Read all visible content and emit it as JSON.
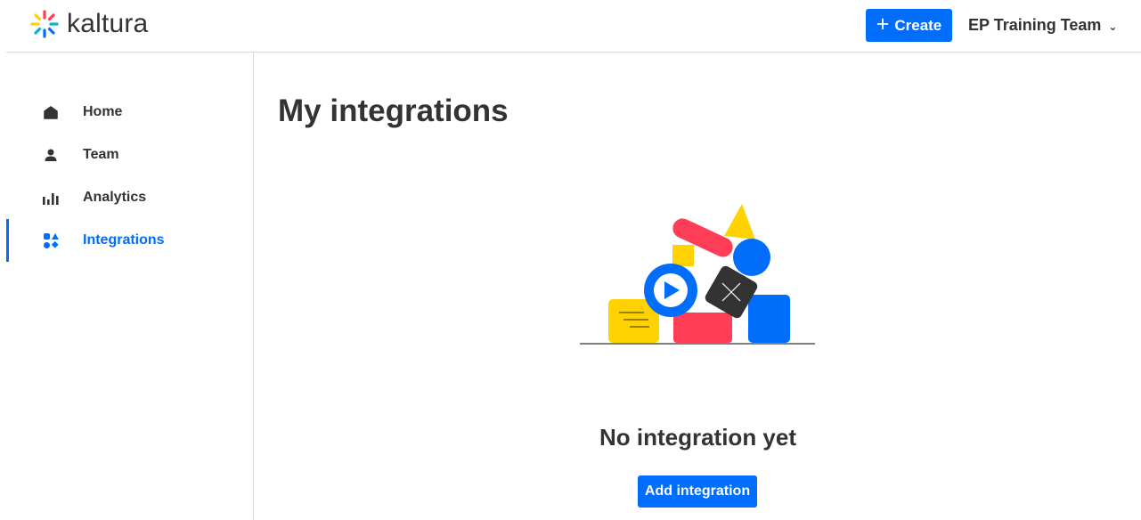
{
  "header": {
    "logo_text": "kaltura",
    "create_label": "Create",
    "team_name": "EP Training Team"
  },
  "sidebar": {
    "items": [
      {
        "label": "Home",
        "icon": "home-icon",
        "active": false
      },
      {
        "label": "Team",
        "icon": "person-icon",
        "active": false
      },
      {
        "label": "Analytics",
        "icon": "bar-chart-icon",
        "active": false
      },
      {
        "label": "Integrations",
        "icon": "integrations-icon",
        "active": true
      }
    ]
  },
  "main": {
    "title": "My integrations",
    "empty_title": "No integration yet",
    "add_button_label": "Add integration"
  },
  "colors": {
    "accent": "#006efa",
    "text": "#333333",
    "yellow": "#ffd200",
    "red": "#ff3d57",
    "dark": "#333333"
  }
}
